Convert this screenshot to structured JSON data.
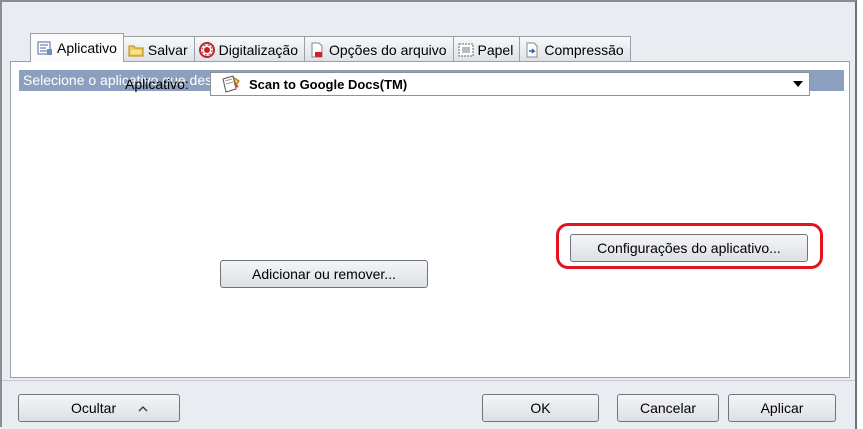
{
  "tabs": [
    {
      "label": "Aplicativo",
      "icon": "application-icon",
      "active": true
    },
    {
      "label": "Salvar",
      "icon": "folder-icon",
      "active": false
    },
    {
      "label": "Digitalização",
      "icon": "scan-icon",
      "active": false
    },
    {
      "label": "Opções do arquivo",
      "icon": "file-options-icon",
      "active": false
    },
    {
      "label": "Papel",
      "icon": "paper-icon",
      "active": false
    },
    {
      "label": "Compressão",
      "icon": "compression-icon",
      "active": false
    }
  ],
  "banner": "Selecione o aplicativo que deseja utilizar.",
  "application": {
    "label": "Aplicativo:",
    "selected": "Scan to Google Docs(TM)",
    "icon": "google-docs-icon"
  },
  "buttons": {
    "app_settings": "Configurações do aplicativo...",
    "add_remove": "Adicionar ou remover...",
    "hide": "Ocultar",
    "ok": "OK",
    "cancel": "Cancelar",
    "apply": "Aplicar"
  },
  "colors": {
    "banner": "#8c9fbf",
    "highlight": "#e3141f"
  }
}
